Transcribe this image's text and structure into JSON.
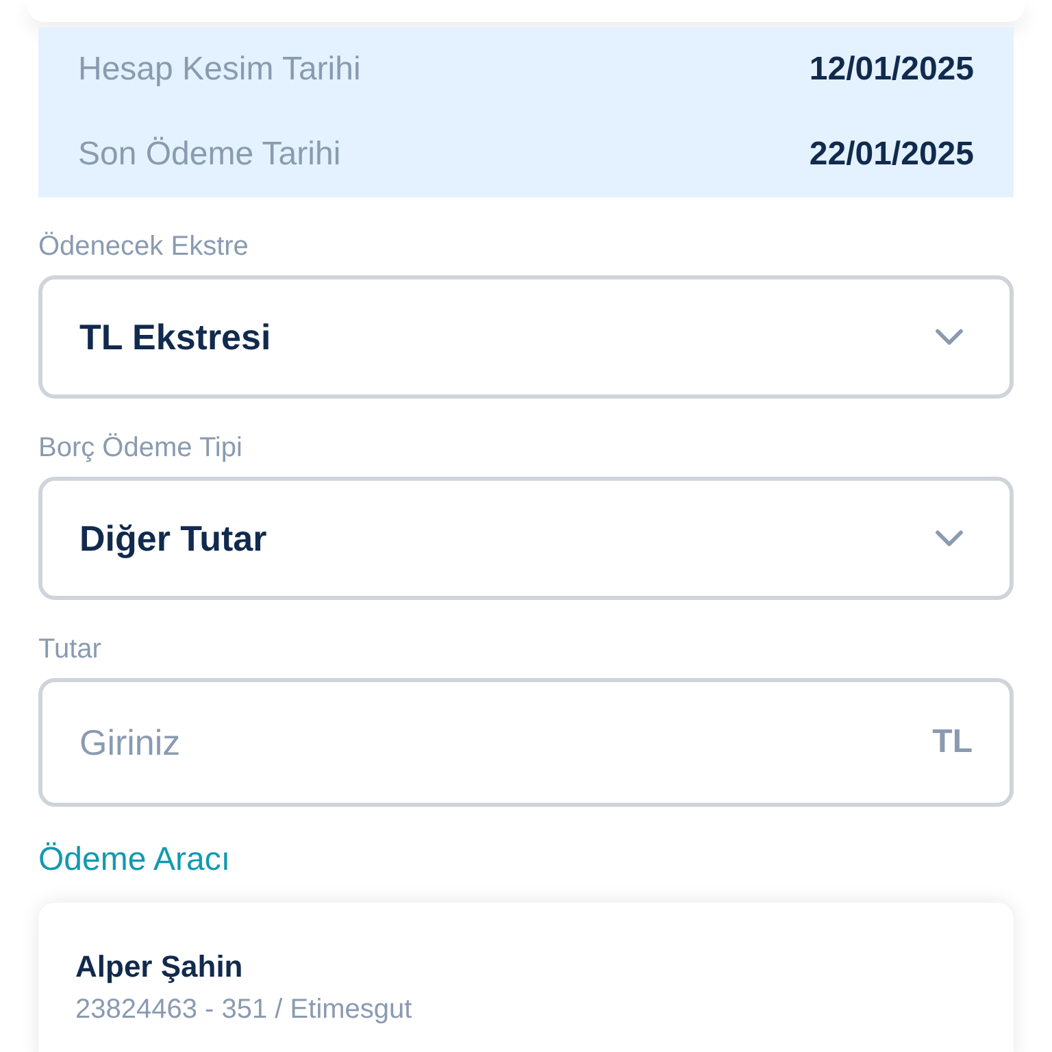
{
  "info_rows": [
    {
      "label": "Hesap Kesim Tarihi",
      "value": "12/01/2025"
    },
    {
      "label": "Son Ödeme Tarihi",
      "value": "22/01/2025"
    }
  ],
  "fields": [
    {
      "kind": "select",
      "label": "Ödenecek Ekstre",
      "value": "TL Ekstresi"
    },
    {
      "kind": "select",
      "label": "Borç Ödeme Tipi",
      "value": "Diğer Tutar"
    },
    {
      "kind": "input",
      "label": "Tutar",
      "placeholder": "Giriniz",
      "suffix": "TL"
    }
  ],
  "payment_section": {
    "title": "Ödeme Aracı",
    "name": "Alper Şahin",
    "detail": "23824463 - 351 / Etimesgut"
  }
}
